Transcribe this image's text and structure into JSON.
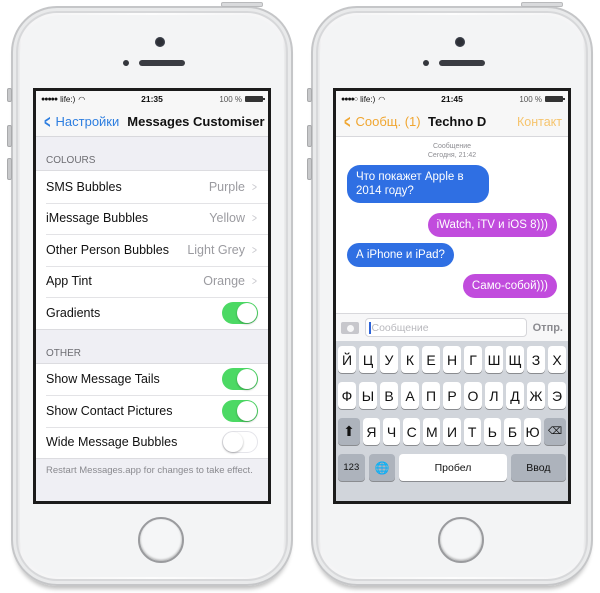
{
  "left_phone": {
    "status_bar": {
      "signal": "●●●●●",
      "carrier": "life:)",
      "time": "21:35",
      "battery": "100 %"
    },
    "nav": {
      "back_label": "Настройки",
      "title": "Messages Customiser"
    },
    "sections": [
      {
        "header": "COLOURS",
        "rows": [
          {
            "label": "SMS Bubbles",
            "value": "Purple"
          },
          {
            "label": "iMessage Bubbles",
            "value": "Yellow"
          },
          {
            "label": "Other Person Bubbles",
            "value": "Light Grey"
          },
          {
            "label": "App Tint",
            "value": "Orange"
          },
          {
            "label": "Gradients",
            "toggle": true
          }
        ]
      },
      {
        "header": "OTHER",
        "rows": [
          {
            "label": "Show Message Tails",
            "toggle": true
          },
          {
            "label": "Show Contact Pictures",
            "toggle": true
          },
          {
            "label": "Wide Message Bubbles",
            "toggle": false
          }
        ]
      }
    ],
    "footer": "Restart Messages.app for changes to take effect."
  },
  "right_phone": {
    "status_bar": {
      "signal": "●●●●○",
      "carrier": "life:)",
      "time": "21:45",
      "battery": "100 %"
    },
    "nav": {
      "back_label": "Сообщ. (1)",
      "title": "Techno D",
      "action": "Контакт"
    },
    "chat_meta": {
      "type": "Сообщение",
      "date": "Сегодня, 21:42"
    },
    "messages": [
      {
        "from": "them",
        "text": "Что покажет Apple  в 2014 году?"
      },
      {
        "from": "me",
        "text": "iWatch, iTV и iOS 8)))"
      },
      {
        "from": "them",
        "text": "А iPhone и iPad?"
      },
      {
        "from": "me",
        "text": "Само-собой)))"
      }
    ],
    "input": {
      "placeholder": "Сообщение",
      "send_label": "Отпр."
    },
    "keyboard": {
      "row1": [
        "Й",
        "Ц",
        "У",
        "К",
        "Е",
        "Н",
        "Г",
        "Ш",
        "Щ",
        "З",
        "Х"
      ],
      "row2": [
        "Ф",
        "Ы",
        "В",
        "А",
        "П",
        "Р",
        "О",
        "Л",
        "Д",
        "Ж",
        "Э"
      ],
      "row3": [
        "Я",
        "Ч",
        "С",
        "М",
        "И",
        "Т",
        "Ь",
        "Б",
        "Ю"
      ],
      "num_label": "123",
      "globe": "🌐",
      "shift": "⬆",
      "delete": "⌫",
      "space_label": "Пробел",
      "enter_label": "Ввод"
    }
  },
  "colors": {
    "ios_blue": "#2d7ee0",
    "toggle_on": "#4cd964",
    "app_tint_orange": "#f0a631",
    "bubble_them": "#2f6fe3",
    "bubble_me": "#c14cdd"
  }
}
